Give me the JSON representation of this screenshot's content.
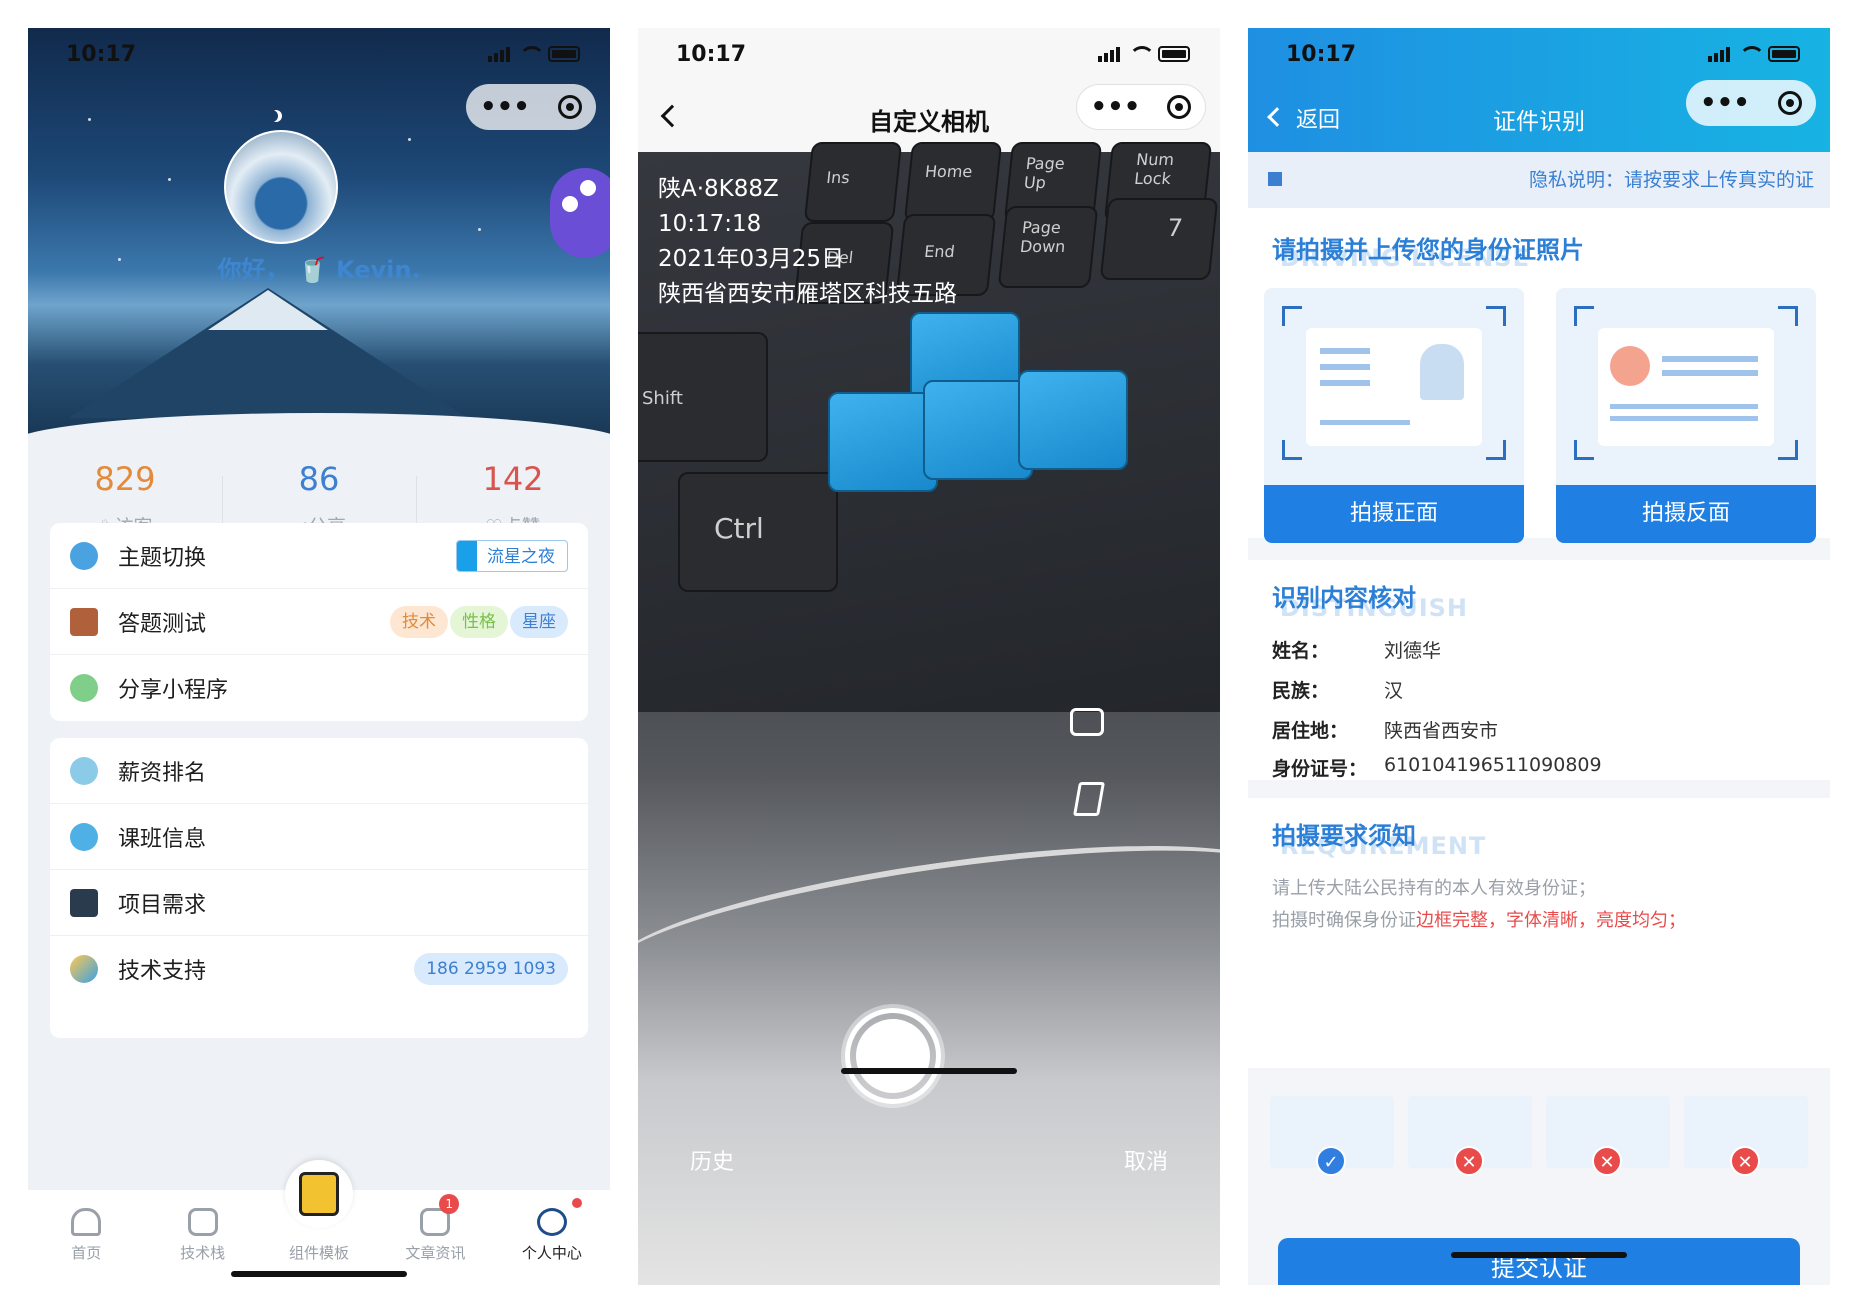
{
  "profile": {
    "time": "10:17",
    "greeting": "你好， 🥤 Kevin.",
    "stats": [
      {
        "value": "829",
        "label": "♘访客",
        "color": "#e38a3b"
      },
      {
        "value": "86",
        "label": "<分享",
        "color": "#3d7fd0"
      },
      {
        "value": "142",
        "label": "♡点赞",
        "color": "#d9534f"
      }
    ],
    "menu1": [
      {
        "label": "主题切换",
        "tag": "流星之夜"
      },
      {
        "label": "答题测试",
        "tags": [
          "技术",
          "性格",
          "星座"
        ]
      },
      {
        "label": "分享小程序"
      }
    ],
    "menu2": [
      {
        "label": "薪资排名"
      },
      {
        "label": "课班信息"
      },
      {
        "label": "项目需求"
      },
      {
        "label": "技术支持",
        "tag": "186 2959 1093"
      }
    ],
    "tabs": [
      {
        "label": "首页"
      },
      {
        "label": "技术栈"
      },
      {
        "label": "组件模板"
      },
      {
        "label": "文章资讯",
        "badge": "1"
      },
      {
        "label": "个人中心"
      }
    ]
  },
  "camera": {
    "time": "10:17",
    "title": "自定义相机",
    "watermark": {
      "plate": "陕A·8K88Z",
      "time": "10:17:18",
      "date": "2021年03月25日",
      "address": "陕西省西安市雁塔区科技五路"
    },
    "keys": {
      "ins": "Ins",
      "home": "Home",
      "pgup": "Page Up",
      "numlock": "Num Lock",
      "del": "Del",
      "end": "End",
      "pgdn": "Page Down",
      "seven": "7",
      "shift": "Shift",
      "ctrl": "Ctrl"
    },
    "history": "历史",
    "cancel": "取消"
  },
  "idverify": {
    "time": "10:17",
    "back": "返回",
    "title": "证件识别",
    "notice": "隐私说明：请按要求上传真实的证",
    "upload_title": "请拍摄并上传您的身份证照片",
    "upload_bg": "DRIVING LICENSE",
    "front_btn": "拍摄正面",
    "back_btn": "拍摄反面",
    "verify_title": "识别内容核对",
    "verify_bg": "DISTINGUISH",
    "fields": [
      {
        "k": "姓名：",
        "v": "刘德华"
      },
      {
        "k": "民族：",
        "v": "汉"
      },
      {
        "k": "居住地：",
        "v": "陕西省西安市"
      },
      {
        "k": "身份证号：",
        "v": "610104196511090809"
      }
    ],
    "req_title": "拍摄要求须知",
    "req_bg": "REQUIREMENT",
    "tip1": "请上传大陆公民持有的本人有效身份证；",
    "tip2a": "拍摄时确保身份证",
    "tip2b": "边框完整，字体清晰，亮度均匀；",
    "submit": "提交认证",
    "colors": {
      "accent": "#1f7fe3",
      "ok": "#2f7ee0",
      "bad": "#e94b4b"
    }
  }
}
